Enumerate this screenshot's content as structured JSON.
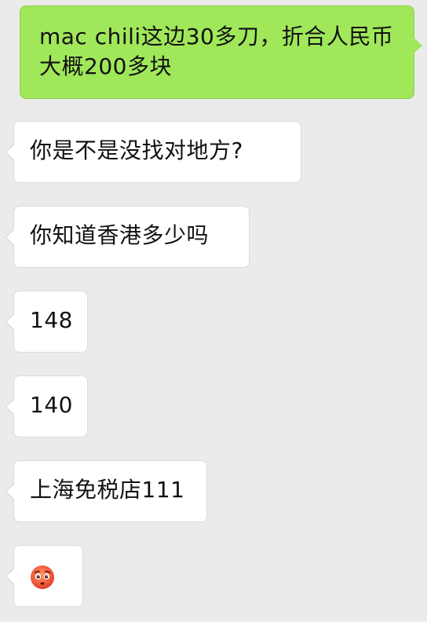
{
  "messages": [
    {
      "direction": "outgoing",
      "text": "mac chili这边30多刀，折合人民币大概200多块"
    },
    {
      "direction": "incoming",
      "text": "你是不是没找对地方?"
    },
    {
      "direction": "incoming",
      "text": "你知道香港多少吗"
    },
    {
      "direction": "incoming",
      "text": "148"
    },
    {
      "direction": "incoming",
      "text": "140"
    },
    {
      "direction": "incoming",
      "text": "上海免税店111"
    },
    {
      "direction": "incoming",
      "emoji": "flushed-face-emoji"
    }
  ],
  "colors": {
    "background": "#ebebeb",
    "outgoing_bubble": "#a0e75a",
    "incoming_bubble": "#ffffff"
  }
}
